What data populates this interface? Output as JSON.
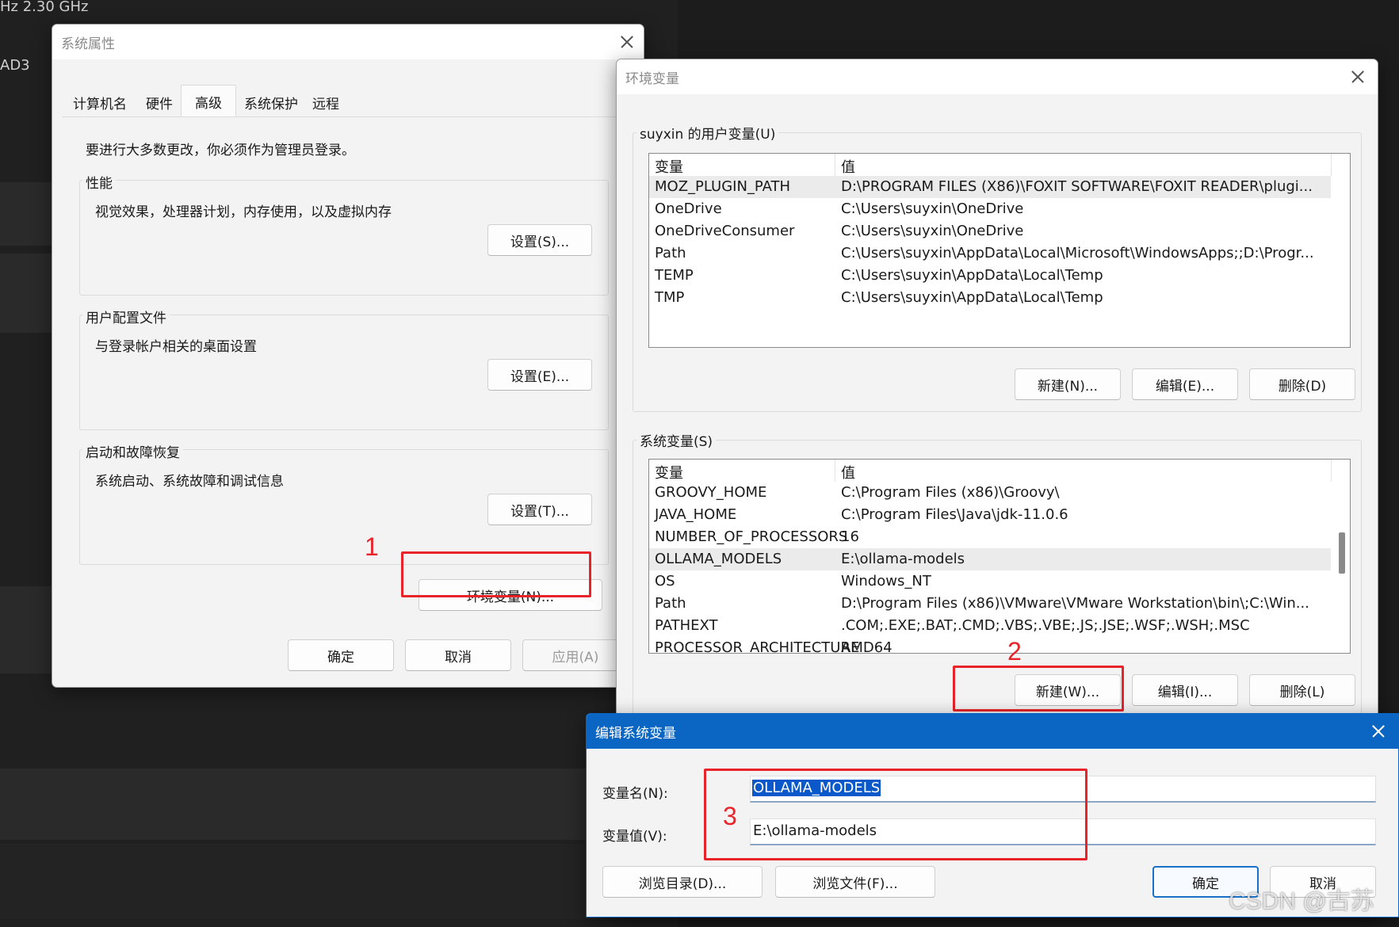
{
  "background": {
    "freq_text": "Hz   2.30 GHz",
    "side_text": "AD3"
  },
  "sys_props": {
    "title": "系统属性",
    "tabs": [
      "计算机名",
      "硬件",
      "高级",
      "系统保护",
      "远程"
    ],
    "active_tab": "高级",
    "admin_notice": "要进行大多数更改，你必须作为管理员登录。",
    "performance": {
      "title": "性能",
      "desc": "视觉效果，处理器计划，内存使用，以及虚拟内存",
      "button": "设置(S)..."
    },
    "user_profiles": {
      "title": "用户配置文件",
      "desc": "与登录帐户相关的桌面设置",
      "button": "设置(E)..."
    },
    "startup": {
      "title": "启动和故障恢复",
      "desc": "系统启动、系统故障和调试信息",
      "button": "设置(T)..."
    },
    "env_button": "环境变量(N)...",
    "ok": "确定",
    "cancel": "取消",
    "apply": "应用(A)"
  },
  "env_vars": {
    "title": "环境变量",
    "user_section": "suyxin 的用户变量(U)",
    "col_var": "变量",
    "col_val": "值",
    "user_vars": [
      {
        "name": "MOZ_PLUGIN_PATH",
        "value": "D:\\PROGRAM FILES (X86)\\FOXIT SOFTWARE\\FOXIT READER\\plugi..."
      },
      {
        "name": "OneDrive",
        "value": "C:\\Users\\suyxin\\OneDrive"
      },
      {
        "name": "OneDriveConsumer",
        "value": "C:\\Users\\suyxin\\OneDrive"
      },
      {
        "name": "Path",
        "value": "C:\\Users\\suyxin\\AppData\\Local\\Microsoft\\WindowsApps;;D:\\Progr..."
      },
      {
        "name": "TEMP",
        "value": "C:\\Users\\suyxin\\AppData\\Local\\Temp"
      },
      {
        "name": "TMP",
        "value": "C:\\Users\\suyxin\\AppData\\Local\\Temp"
      }
    ],
    "user_buttons": {
      "new": "新建(N)...",
      "edit": "编辑(E)...",
      "delete": "删除(D)"
    },
    "sys_section": "系统变量(S)",
    "sys_vars": [
      {
        "name": "GROOVY_HOME",
        "value": "C:\\Program Files (x86)\\Groovy\\"
      },
      {
        "name": "JAVA_HOME",
        "value": "C:\\Program Files\\Java\\jdk-11.0.6"
      },
      {
        "name": "NUMBER_OF_PROCESSORS",
        "value": "16"
      },
      {
        "name": "OLLAMA_MODELS",
        "value": "E:\\ollama-models"
      },
      {
        "name": "OS",
        "value": "Windows_NT"
      },
      {
        "name": "Path",
        "value": "D:\\Program Files (x86)\\VMware\\VMware Workstation\\bin\\;C:\\Win..."
      },
      {
        "name": "PATHEXT",
        "value": ".COM;.EXE;.BAT;.CMD;.VBS;.VBE;.JS;.JSE;.WSF;.WSH;.MSC"
      },
      {
        "name": "PROCESSOR_ARCHITECTURE",
        "value": "AMD64"
      }
    ],
    "sys_buttons": {
      "new": "新建(W)...",
      "edit": "编辑(I)...",
      "delete": "删除(L)"
    }
  },
  "edit_dialog": {
    "title": "编辑系统变量",
    "name_label": "变量名(N):",
    "value_label": "变量值(V):",
    "name_value": "OLLAMA_MODELS",
    "value_value": "E:\\ollama-models",
    "browse_dir": "浏览目录(D)...",
    "browse_file": "浏览文件(F)...",
    "ok": "确定",
    "cancel": "取消"
  },
  "annotations": {
    "step1": "1",
    "step2": "2",
    "step3": "3"
  },
  "watermark": "CSDN @古苏",
  "colors": {
    "annotation_red": "#e8232a",
    "dialog_title_blue": "#0a66c2",
    "selection_blue": "#0a58ca"
  }
}
